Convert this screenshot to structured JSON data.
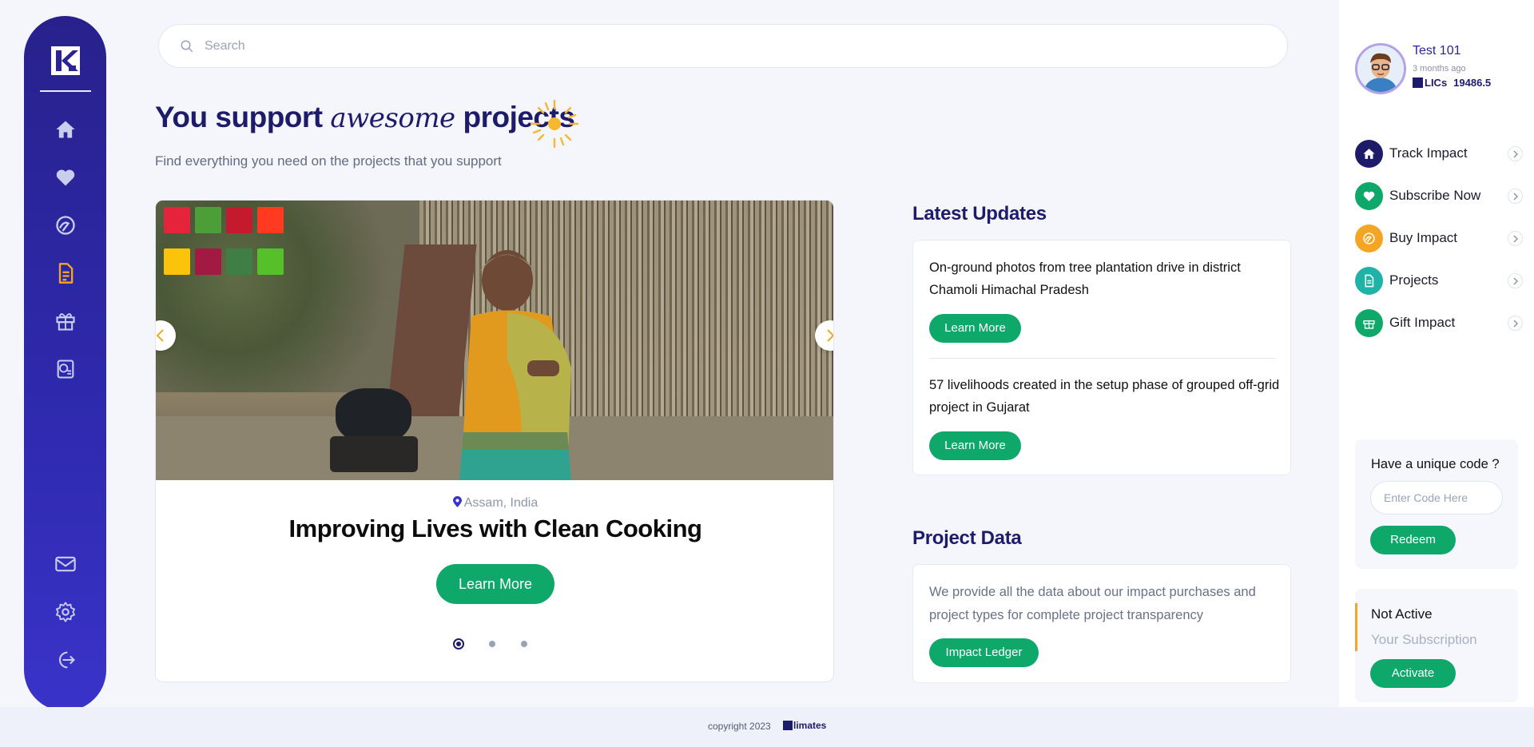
{
  "search": {
    "placeholder": "Search"
  },
  "hero": {
    "title_part1": "You support",
    "title_script": "awesome",
    "title_part2": "projects",
    "subtitle": "Find everything you need on the projects that you support"
  },
  "left_nav": {
    "items": [
      "home-icon",
      "heart-icon",
      "impact-icon",
      "document-icon",
      "gift-icon",
      "ledger-icon"
    ],
    "bottom": [
      "mail-icon",
      "settings-icon",
      "logout-icon"
    ],
    "active_index": 3,
    "active_color": "#f5a524"
  },
  "carousel": {
    "location": "Assam, India",
    "title": "Improving Lives with Clean Cooking",
    "button_label": "Learn More",
    "slide_count": 3,
    "active_slide": 0
  },
  "latest_updates": {
    "title": "Latest Updates",
    "items": [
      {
        "text": "On-ground photos from tree plantation drive in district Chamoli Himachal Pradesh",
        "button": "Learn More"
      },
      {
        "text": "57 livelihoods created in the setup phase of grouped off-grid project in Gujarat",
        "button": "Learn More"
      }
    ]
  },
  "project_data": {
    "title": "Project Data",
    "text": "We provide all the data about our impact purchases and project types for complete project transparency",
    "button": "Impact Ledger"
  },
  "user": {
    "name": "Test 101",
    "time": "3 months ago",
    "klics_label": "LICs",
    "klics_value": "19486.5"
  },
  "right_menu": [
    {
      "label": "Track Impact",
      "color": "#1e1b6b",
      "icon": "home-icon"
    },
    {
      "label": "Subscribe Now",
      "color": "#0ea86a",
      "icon": "heart-icon"
    },
    {
      "label": "Buy Impact",
      "color": "#f5a524",
      "icon": "impact-icon"
    },
    {
      "label": "Projects",
      "color": "#1fb3a8",
      "icon": "document-icon"
    },
    {
      "label": "Gift Impact",
      "color": "#0ea86a",
      "icon": "gift-icon"
    }
  ],
  "code_box": {
    "question": "Have a unique code ?",
    "placeholder": "Enter Code Here",
    "button": "Redeem"
  },
  "subscription": {
    "status": "Not Active",
    "label": "Your Subscription",
    "button": "Activate"
  },
  "footer": {
    "copyright": "copyright 2023",
    "brand": "limates"
  },
  "colors": {
    "primary": "#1e1b6b",
    "green": "#0ea86a",
    "accent": "#f5a524"
  }
}
